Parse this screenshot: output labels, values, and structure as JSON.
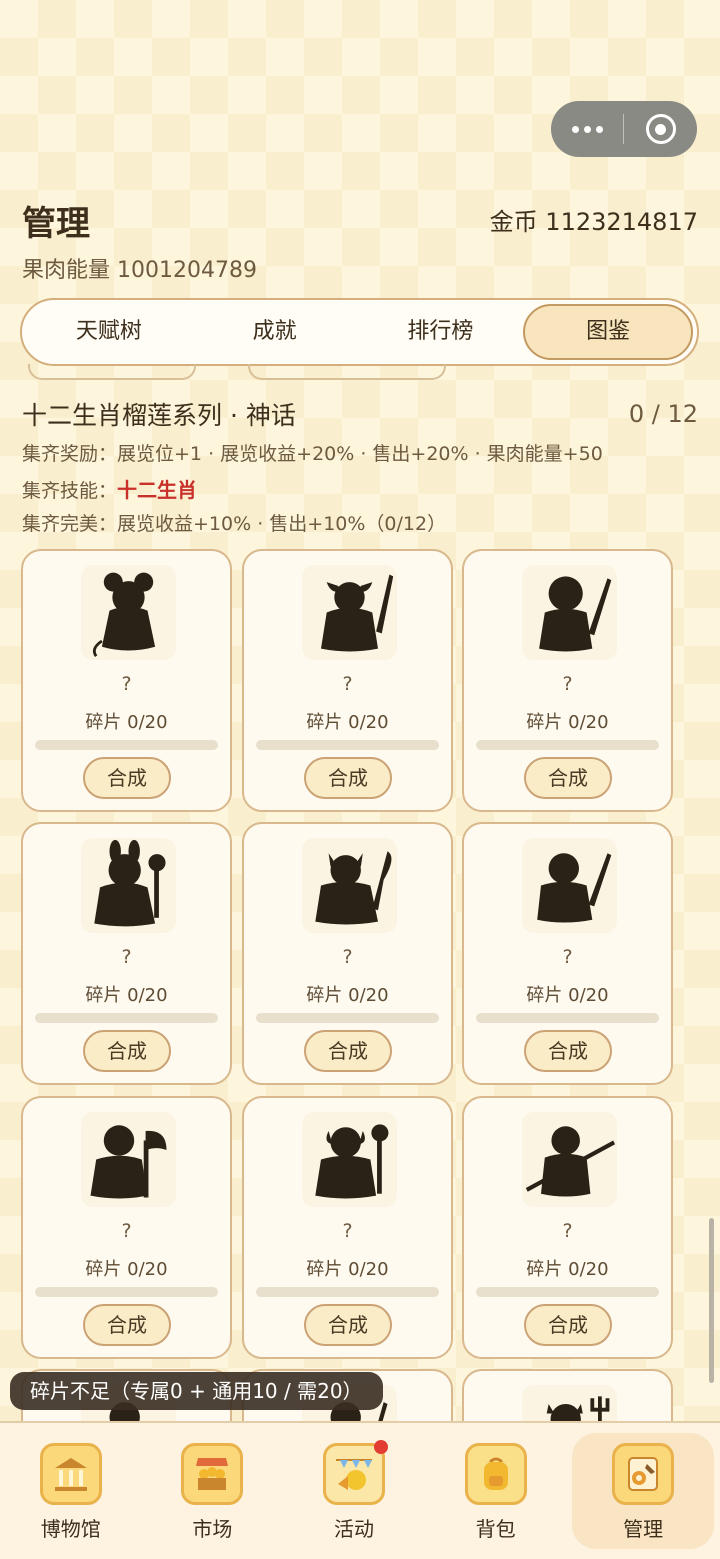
{
  "header": {
    "title": "管理",
    "gold": "金币 1123214817",
    "energy": "果肉能量 1001204789"
  },
  "tabs": [
    {
      "label": "天赋树",
      "active": false
    },
    {
      "label": "成就",
      "active": false
    },
    {
      "label": "排行榜",
      "active": false
    },
    {
      "label": "图鉴",
      "active": true
    }
  ],
  "series": {
    "title": "十二生肖榴莲系列 · 神话",
    "count": "0 / 12",
    "reward_label": "集齐奖励：",
    "reward_text": "展览位+1 · 展览收益+20% · 售出+20% · 果肉能量+50",
    "skill_label": "集齐技能：",
    "skill_name": "十二生肖",
    "perfect_label": "集齐完美：",
    "perfect_text": "展览收益+10% · 售出+10%（0/12）"
  },
  "cards": [
    {
      "name": "?",
      "fragments": "碎片 0/20",
      "progress": 0,
      "button": "合成",
      "icon": "rat-silhouette-icon"
    },
    {
      "name": "?",
      "fragments": "碎片 0/20",
      "progress": 0,
      "button": "合成",
      "icon": "ox-warrior-silhouette-icon"
    },
    {
      "name": "?",
      "fragments": "碎片 0/20",
      "progress": 0,
      "button": "合成",
      "icon": "tiger-warrior-silhouette-icon"
    },
    {
      "name": "?",
      "fragments": "碎片 0/20",
      "progress": 0,
      "button": "合成",
      "icon": "rabbit-silhouette-icon"
    },
    {
      "name": "?",
      "fragments": "碎片 0/20",
      "progress": 0,
      "button": "合成",
      "icon": "dragon-warrior-silhouette-icon"
    },
    {
      "name": "?",
      "fragments": "碎片 0/20",
      "progress": 0,
      "button": "合成",
      "icon": "snake-warrior-silhouette-icon"
    },
    {
      "name": "?",
      "fragments": "碎片 0/20",
      "progress": 0,
      "button": "合成",
      "icon": "horse-axe-silhouette-icon"
    },
    {
      "name": "?",
      "fragments": "碎片 0/20",
      "progress": 0,
      "button": "合成",
      "icon": "goat-mace-silhouette-icon"
    },
    {
      "name": "?",
      "fragments": "碎片 0/20",
      "progress": 0,
      "button": "合成",
      "icon": "monkey-staff-silhouette-icon"
    },
    {
      "name": "",
      "fragments": "",
      "progress": 0,
      "button": "",
      "icon": "rooster-silhouette-icon"
    },
    {
      "name": "",
      "fragments": "",
      "progress": 0,
      "button": "",
      "icon": "dog-silhouette-icon"
    },
    {
      "name": "",
      "fragments": "",
      "progress": 0,
      "button": "",
      "icon": "pig-trident-silhouette-icon"
    }
  ],
  "toast": "碎片不足（专属0 + 通用10 / 需20）",
  "nav": [
    {
      "label": "博物馆",
      "icon": "museum-icon",
      "active": false,
      "badge": false
    },
    {
      "label": "市场",
      "icon": "market-stall-icon",
      "active": false,
      "badge": false
    },
    {
      "label": "活动",
      "icon": "event-party-icon",
      "active": false,
      "badge": true
    },
    {
      "label": "背包",
      "icon": "backpack-icon",
      "active": false,
      "badge": false
    },
    {
      "label": "管理",
      "icon": "manage-tools-icon",
      "active": true,
      "badge": false
    }
  ],
  "colors": {
    "accent": "#c8302a",
    "card_border": "#d8b88c",
    "button_fill": "#fbecc8",
    "tab_active": "#f8e5bd",
    "silhouette": "#2a2216"
  }
}
